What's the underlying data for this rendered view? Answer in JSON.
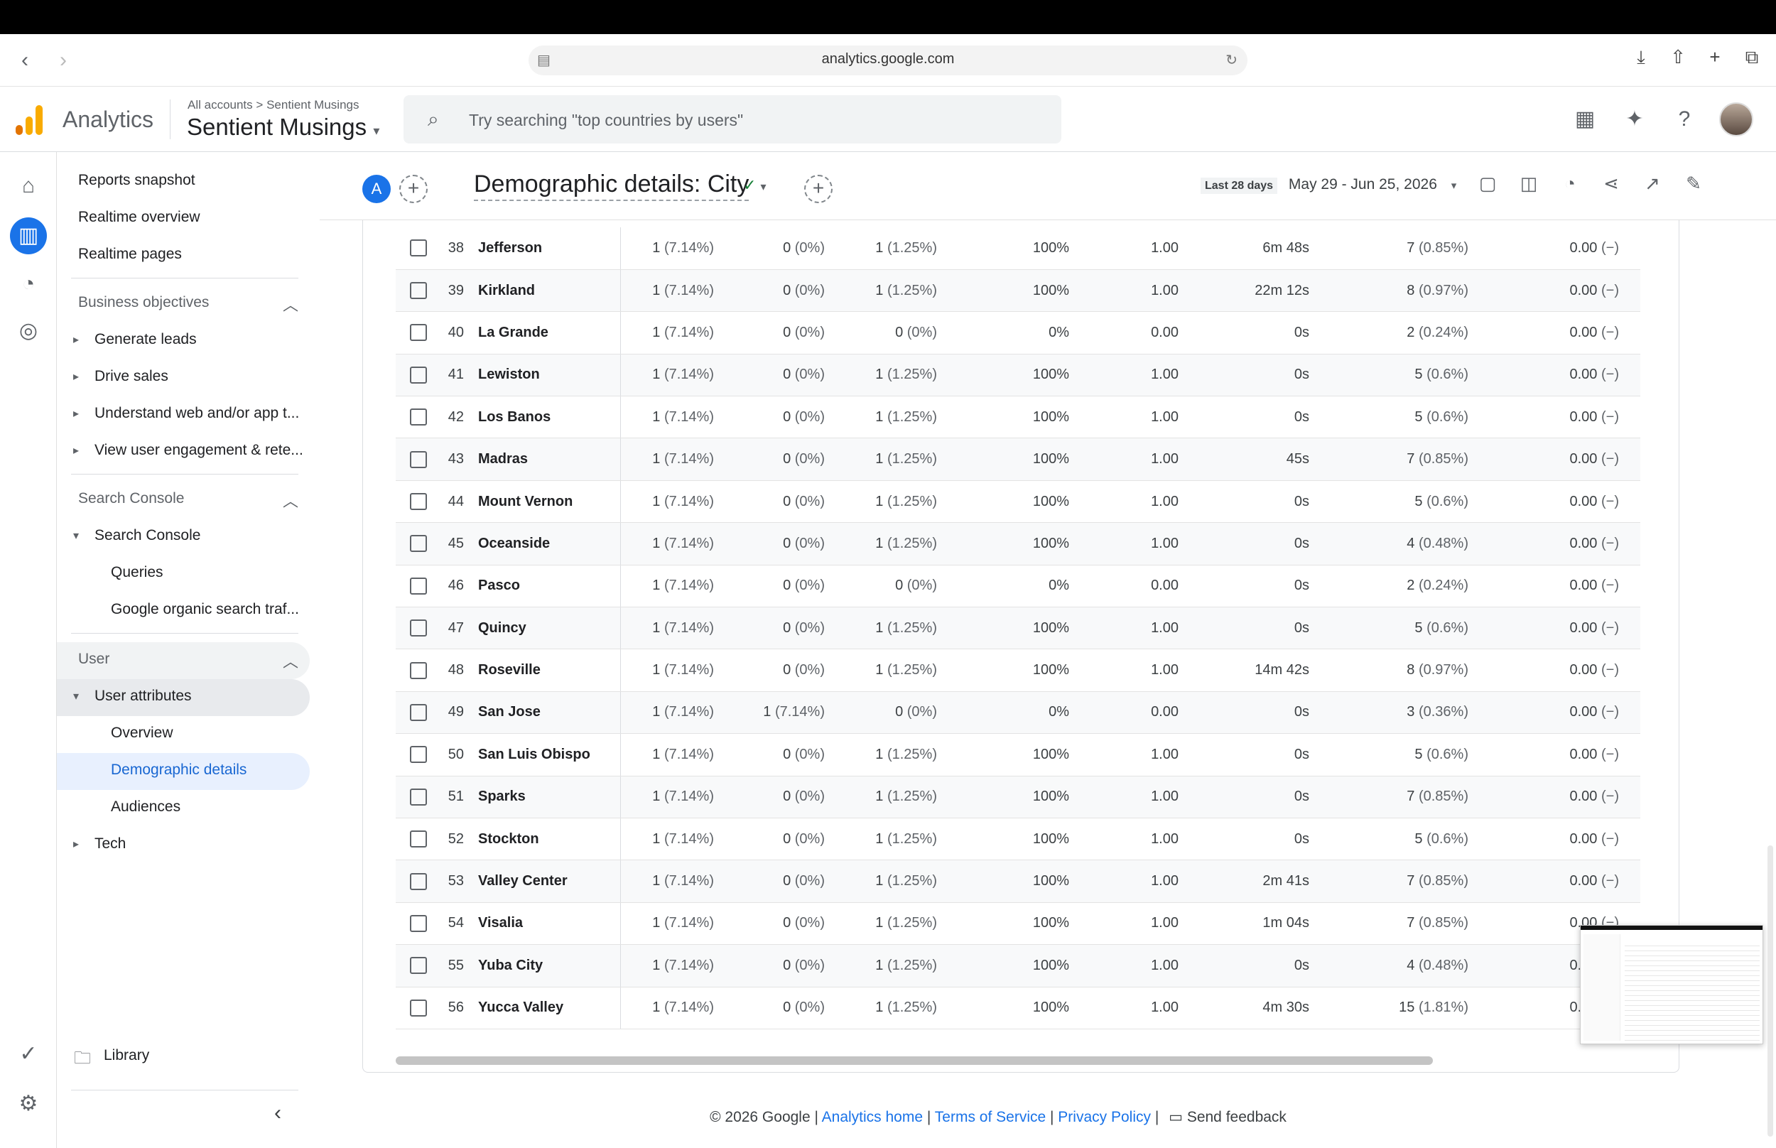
{
  "browser": {
    "url": "analytics.google.com"
  },
  "header": {
    "app_name": "Analytics",
    "breadcrumb_root": "All accounts",
    "breadcrumb_sep": ">",
    "breadcrumb_account": "Sentient Musings",
    "property": "Sentient Musings",
    "search_placeholder": "Try searching \"top countries by users\""
  },
  "colors": {
    "accent": "#1a73e8",
    "logo_orange": "#f9ab00",
    "logo_dark": "#e37400"
  },
  "sidebar": {
    "reports_snapshot": "Reports snapshot",
    "realtime_overview": "Realtime overview",
    "realtime_pages": "Realtime pages",
    "business_objectives": "Business objectives",
    "generate_leads": "Generate leads",
    "drive_sales": "Drive sales",
    "understand_web": "Understand web and/or app t...",
    "view_user_engagement": "View user engagement & rete...",
    "search_console_section": "Search Console",
    "search_console": "Search Console",
    "queries": "Queries",
    "google_organic": "Google organic search traf...",
    "user_section": "User",
    "user_attributes": "User attributes",
    "overview": "Overview",
    "demographic_details": "Demographic details",
    "audiences": "Audiences",
    "tech": "Tech",
    "library": "Library"
  },
  "report": {
    "segment_badge": "A",
    "title": "Demographic details: City",
    "date_label": "Last 28 days",
    "date_range": "May 29 - Jun 25, 2026"
  },
  "rows": [
    {
      "n": "38",
      "city": "Jefferson",
      "a": "1",
      "ap": "(7.14%)",
      "b": "0",
      "bp": "(0%)",
      "c": "1",
      "cp": "(1.25%)",
      "d": "100%",
      "e": "1.00",
      "f": "6m 48s",
      "g": "7",
      "gp": "(0.85%)",
      "h": "0.00",
      "hp": "(−)"
    },
    {
      "n": "39",
      "city": "Kirkland",
      "a": "1",
      "ap": "(7.14%)",
      "b": "0",
      "bp": "(0%)",
      "c": "1",
      "cp": "(1.25%)",
      "d": "100%",
      "e": "1.00",
      "f": "22m 12s",
      "g": "8",
      "gp": "(0.97%)",
      "h": "0.00",
      "hp": "(−)"
    },
    {
      "n": "40",
      "city": "La Grande",
      "a": "1",
      "ap": "(7.14%)",
      "b": "0",
      "bp": "(0%)",
      "c": "0",
      "cp": "(0%)",
      "d": "0%",
      "e": "0.00",
      "f": "0s",
      "g": "2",
      "gp": "(0.24%)",
      "h": "0.00",
      "hp": "(−)"
    },
    {
      "n": "41",
      "city": "Lewiston",
      "a": "1",
      "ap": "(7.14%)",
      "b": "0",
      "bp": "(0%)",
      "c": "1",
      "cp": "(1.25%)",
      "d": "100%",
      "e": "1.00",
      "f": "0s",
      "g": "5",
      "gp": "(0.6%)",
      "h": "0.00",
      "hp": "(−)"
    },
    {
      "n": "42",
      "city": "Los Banos",
      "a": "1",
      "ap": "(7.14%)",
      "b": "0",
      "bp": "(0%)",
      "c": "1",
      "cp": "(1.25%)",
      "d": "100%",
      "e": "1.00",
      "f": "0s",
      "g": "5",
      "gp": "(0.6%)",
      "h": "0.00",
      "hp": "(−)"
    },
    {
      "n": "43",
      "city": "Madras",
      "a": "1",
      "ap": "(7.14%)",
      "b": "0",
      "bp": "(0%)",
      "c": "1",
      "cp": "(1.25%)",
      "d": "100%",
      "e": "1.00",
      "f": "45s",
      "g": "7",
      "gp": "(0.85%)",
      "h": "0.00",
      "hp": "(−)"
    },
    {
      "n": "44",
      "city": "Mount Vernon",
      "a": "1",
      "ap": "(7.14%)",
      "b": "0",
      "bp": "(0%)",
      "c": "1",
      "cp": "(1.25%)",
      "d": "100%",
      "e": "1.00",
      "f": "0s",
      "g": "5",
      "gp": "(0.6%)",
      "h": "0.00",
      "hp": "(−)"
    },
    {
      "n": "45",
      "city": "Oceanside",
      "a": "1",
      "ap": "(7.14%)",
      "b": "0",
      "bp": "(0%)",
      "c": "1",
      "cp": "(1.25%)",
      "d": "100%",
      "e": "1.00",
      "f": "0s",
      "g": "4",
      "gp": "(0.48%)",
      "h": "0.00",
      "hp": "(−)"
    },
    {
      "n": "46",
      "city": "Pasco",
      "a": "1",
      "ap": "(7.14%)",
      "b": "0",
      "bp": "(0%)",
      "c": "0",
      "cp": "(0%)",
      "d": "0%",
      "e": "0.00",
      "f": "0s",
      "g": "2",
      "gp": "(0.24%)",
      "h": "0.00",
      "hp": "(−)"
    },
    {
      "n": "47",
      "city": "Quincy",
      "a": "1",
      "ap": "(7.14%)",
      "b": "0",
      "bp": "(0%)",
      "c": "1",
      "cp": "(1.25%)",
      "d": "100%",
      "e": "1.00",
      "f": "0s",
      "g": "5",
      "gp": "(0.6%)",
      "h": "0.00",
      "hp": "(−)"
    },
    {
      "n": "48",
      "city": "Roseville",
      "a": "1",
      "ap": "(7.14%)",
      "b": "0",
      "bp": "(0%)",
      "c": "1",
      "cp": "(1.25%)",
      "d": "100%",
      "e": "1.00",
      "f": "14m 42s",
      "g": "8",
      "gp": "(0.97%)",
      "h": "0.00",
      "hp": "(−)"
    },
    {
      "n": "49",
      "city": "San Jose",
      "a": "1",
      "ap": "(7.14%)",
      "b": "1",
      "bp": "(7.14%)",
      "c": "0",
      "cp": "(0%)",
      "d": "0%",
      "e": "0.00",
      "f": "0s",
      "g": "3",
      "gp": "(0.36%)",
      "h": "0.00",
      "hp": "(−)"
    },
    {
      "n": "50",
      "city": "San Luis Obispo",
      "a": "1",
      "ap": "(7.14%)",
      "b": "0",
      "bp": "(0%)",
      "c": "1",
      "cp": "(1.25%)",
      "d": "100%",
      "e": "1.00",
      "f": "0s",
      "g": "5",
      "gp": "(0.6%)",
      "h": "0.00",
      "hp": "(−)"
    },
    {
      "n": "51",
      "city": "Sparks",
      "a": "1",
      "ap": "(7.14%)",
      "b": "0",
      "bp": "(0%)",
      "c": "1",
      "cp": "(1.25%)",
      "d": "100%",
      "e": "1.00",
      "f": "0s",
      "g": "7",
      "gp": "(0.85%)",
      "h": "0.00",
      "hp": "(−)"
    },
    {
      "n": "52",
      "city": "Stockton",
      "a": "1",
      "ap": "(7.14%)",
      "b": "0",
      "bp": "(0%)",
      "c": "1",
      "cp": "(1.25%)",
      "d": "100%",
      "e": "1.00",
      "f": "0s",
      "g": "5",
      "gp": "(0.6%)",
      "h": "0.00",
      "hp": "(−)"
    },
    {
      "n": "53",
      "city": "Valley Center",
      "a": "1",
      "ap": "(7.14%)",
      "b": "0",
      "bp": "(0%)",
      "c": "1",
      "cp": "(1.25%)",
      "d": "100%",
      "e": "1.00",
      "f": "2m 41s",
      "g": "7",
      "gp": "(0.85%)",
      "h": "0.00",
      "hp": "(−)"
    },
    {
      "n": "54",
      "city": "Visalia",
      "a": "1",
      "ap": "(7.14%)",
      "b": "0",
      "bp": "(0%)",
      "c": "1",
      "cp": "(1.25%)",
      "d": "100%",
      "e": "1.00",
      "f": "1m 04s",
      "g": "7",
      "gp": "(0.85%)",
      "h": "0.00",
      "hp": "(−)"
    },
    {
      "n": "55",
      "city": "Yuba City",
      "a": "1",
      "ap": "(7.14%)",
      "b": "0",
      "bp": "(0%)",
      "c": "1",
      "cp": "(1.25%)",
      "d": "100%",
      "e": "1.00",
      "f": "0s",
      "g": "4",
      "gp": "(0.48%)",
      "h": "0.00",
      "hp": "(−)"
    },
    {
      "n": "56",
      "city": "Yucca Valley",
      "a": "1",
      "ap": "(7.14%)",
      "b": "0",
      "bp": "(0%)",
      "c": "1",
      "cp": "(1.25%)",
      "d": "100%",
      "e": "1.00",
      "f": "4m 30s",
      "g": "15",
      "gp": "(1.81%)",
      "h": "0.00",
      "hp": "(−)"
    }
  ],
  "footer": {
    "copyright": "© 2026 Google |",
    "analytics_home": "Analytics home",
    "terms": "Terms of Service",
    "privacy": "Privacy Policy",
    "send_feedback": "Send feedback"
  }
}
